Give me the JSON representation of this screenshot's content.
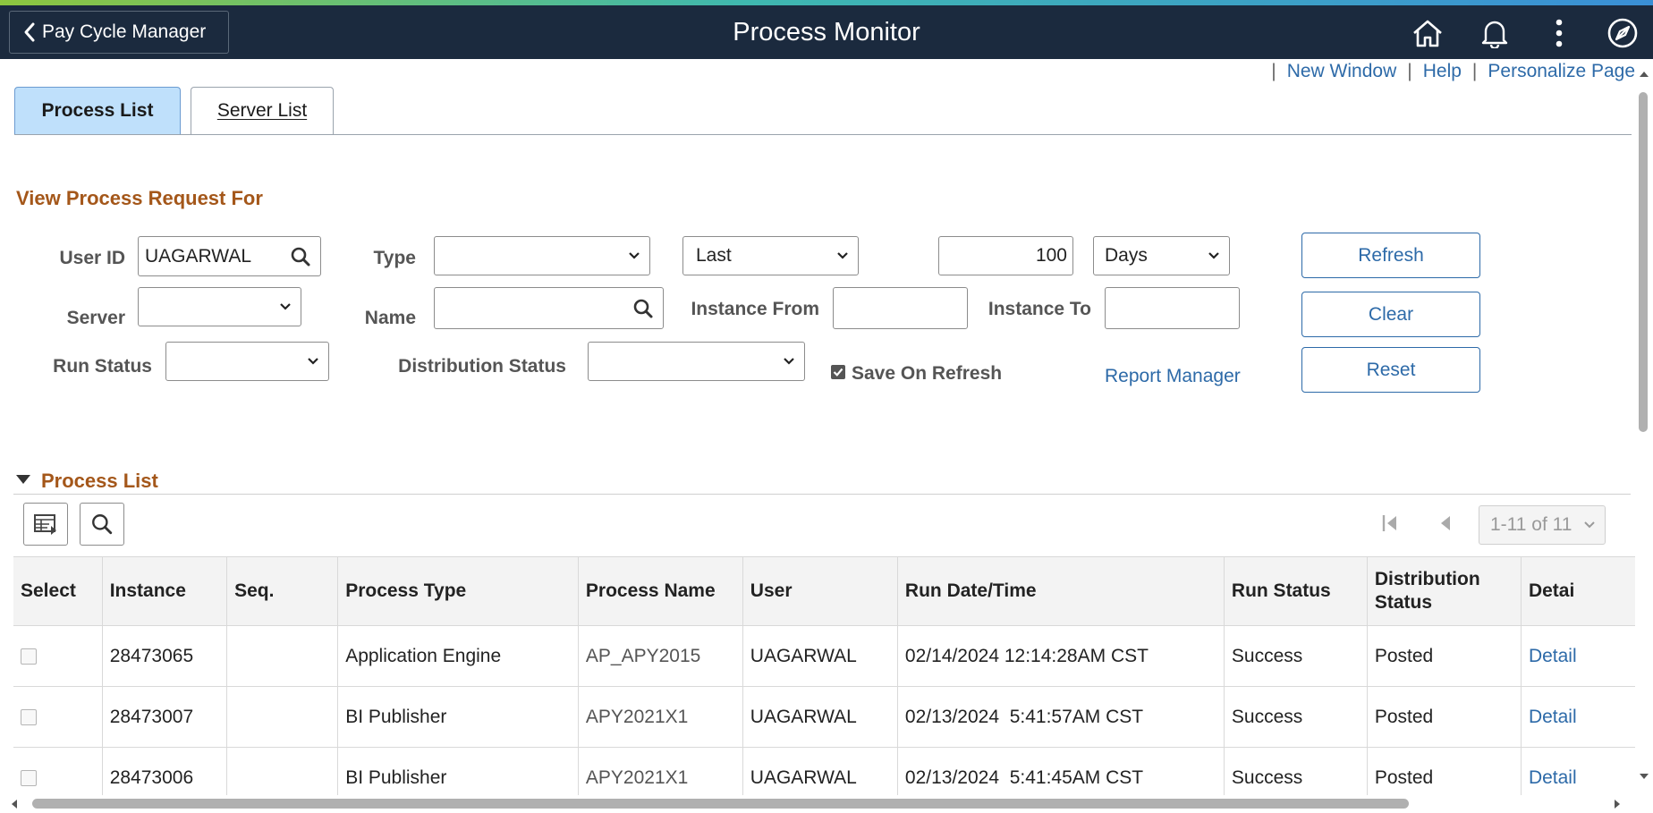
{
  "header": {
    "back_label": "Pay Cycle Manager",
    "title": "Process Monitor"
  },
  "toplinks": {
    "sep": "|",
    "new_window": "New Window",
    "help": "Help",
    "personalize": "Personalize Page"
  },
  "tabs": [
    {
      "label": "Process List",
      "active": true
    },
    {
      "label": "Server List",
      "active": false
    }
  ],
  "filters": {
    "section_title": "View Process Request For",
    "user_id_label": "User ID",
    "user_id_value": "UAGARWAL",
    "type_label": "Type",
    "type_value": "",
    "period_value": "Last",
    "period_count": "100",
    "period_unit": "Days",
    "server_label": "Server",
    "server_value": "",
    "name_label": "Name",
    "name_value": "",
    "instance_from_label": "Instance From",
    "instance_from_value": "",
    "instance_to_label": "Instance To",
    "instance_to_value": "",
    "run_status_label": "Run Status",
    "run_status_value": "",
    "dist_status_label": "Distribution Status",
    "dist_status_value": "",
    "save_on_refresh_label": "Save On Refresh",
    "save_on_refresh_checked": true,
    "report_manager_link": "Report Manager",
    "refresh_button": "Refresh",
    "clear_button": "Clear",
    "reset_button": "Reset"
  },
  "process_list": {
    "section_title": "Process List",
    "pager": "1-11 of 11",
    "columns": [
      "Select",
      "Instance",
      "Seq.",
      "Process Type",
      "Process Name",
      "User",
      "Run Date/Time",
      "Run Status",
      "Distribution Status",
      "Details"
    ],
    "columns_visible": [
      "Select",
      "Instance",
      "Seq.",
      "Process Type",
      "Process Name",
      "User",
      "Run Date/Time",
      "Run Status",
      "Distribution",
      "Status",
      "Detai"
    ],
    "rows": [
      {
        "instance": "28473065",
        "seq": "",
        "process_type": "Application Engine",
        "process_name": "AP_APY2015",
        "user": "UAGARWAL",
        "run_datetime": "02/14/2024 12:14:28AM CST",
        "run_status": "Success",
        "dist_status": "Posted",
        "detail": "Detail"
      },
      {
        "instance": "28473007",
        "seq": "",
        "process_type": "BI Publisher",
        "process_name": "APY2021X1",
        "user": "UAGARWAL",
        "run_datetime": "02/13/2024  5:41:57AM CST",
        "run_status": "Success",
        "dist_status": "Posted",
        "detail": "Detail"
      },
      {
        "instance": "28473006",
        "seq": "",
        "process_type": "BI Publisher",
        "process_name": "APY2021X1",
        "user": "UAGARWAL",
        "run_datetime": "02/13/2024  5:41:45AM CST",
        "run_status": "Success",
        "dist_status": "Posted",
        "detail": "Detail"
      }
    ]
  },
  "colors": {
    "header_bg": "#1b2a3e",
    "link": "#2d6aa8",
    "section_title": "#a4571a",
    "active_tab": "#bfe0fb"
  }
}
